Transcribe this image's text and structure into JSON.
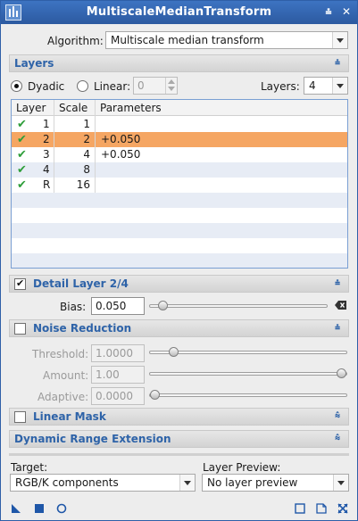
{
  "window": {
    "title": "MultiscaleMedianTransform"
  },
  "algorithm": {
    "label": "Algorithm:",
    "value": "Multiscale median transform"
  },
  "layers_section": {
    "title": "Layers",
    "dyadic_label": "Dyadic",
    "linear_label": "Linear:",
    "linear_value": "0",
    "layers_label": "Layers:",
    "layers_value": "4",
    "table": {
      "headers": [
        "Layer",
        "Scale",
        "Parameters"
      ],
      "rows": [
        {
          "enabled": true,
          "layer": "1",
          "scale": "1",
          "parameters": "",
          "selected": false
        },
        {
          "enabled": true,
          "layer": "2",
          "scale": "2",
          "parameters": "+0.050",
          "selected": true
        },
        {
          "enabled": true,
          "layer": "3",
          "scale": "4",
          "parameters": "+0.050",
          "selected": false
        },
        {
          "enabled": true,
          "layer": "4",
          "scale": "8",
          "parameters": "",
          "selected": false
        },
        {
          "enabled": true,
          "layer": "R",
          "scale": "16",
          "parameters": "",
          "selected": false
        }
      ]
    }
  },
  "detail_layer": {
    "title": "Detail Layer 2/4",
    "checked": true,
    "bias_label": "Bias:",
    "bias_value": "0.050",
    "bias_slider_level": 0.05
  },
  "noise_reduction": {
    "title": "Noise Reduction",
    "checked": false,
    "threshold_label": "Threshold:",
    "threshold_value": "1.0000",
    "threshold_slider_level": 0.1,
    "amount_label": "Amount:",
    "amount_value": "1.00",
    "amount_slider_level": 1.0,
    "adaptive_label": "Adaptive:",
    "adaptive_value": "0.0000",
    "adaptive_slider_level": 0.0
  },
  "linear_mask": {
    "title": "Linear Mask",
    "checked": false
  },
  "dynamic_range": {
    "title": "Dynamic Range Extension"
  },
  "target": {
    "label": "Target:",
    "value": "RGB/K components"
  },
  "layer_preview": {
    "label": "Layer Preview:",
    "value": "No layer preview"
  },
  "colors": {
    "title_bar": "#2c5aa0",
    "section_title": "#2e63a8",
    "selected_row": "#f5a663",
    "check_green": "#2e9e3a"
  }
}
